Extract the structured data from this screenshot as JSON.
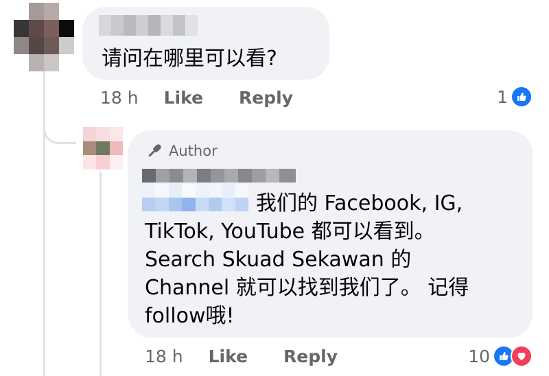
{
  "colors": {
    "bubble_bg": "#f0f2f5",
    "meta_text": "#65676b",
    "like_blue": "#1877f2",
    "love_red": "#f33e58",
    "thread_line": "#dfe1e5"
  },
  "comments": [
    {
      "author_name": "",
      "text": "请问在哪里可以看?",
      "time": "18 h",
      "like_label": "Like",
      "reply_label": "Reply",
      "reaction_count": "1",
      "reaction_icons": [
        "like-icon"
      ]
    },
    {
      "badge": "Author",
      "author_name": "",
      "mention": "",
      "text_lines": [
        "我们的 Facebook, IG,",
        "TikTok, YouTube 都可以看到。",
        "Search Skuad Sekawan 的",
        "Channel 就可以找到我们了。 记得",
        "follow哦!"
      ],
      "time": "18 h",
      "like_label": "Like",
      "reply_label": "Reply",
      "reaction_count": "10",
      "reaction_icons": [
        "like-icon",
        "love-icon"
      ]
    }
  ]
}
